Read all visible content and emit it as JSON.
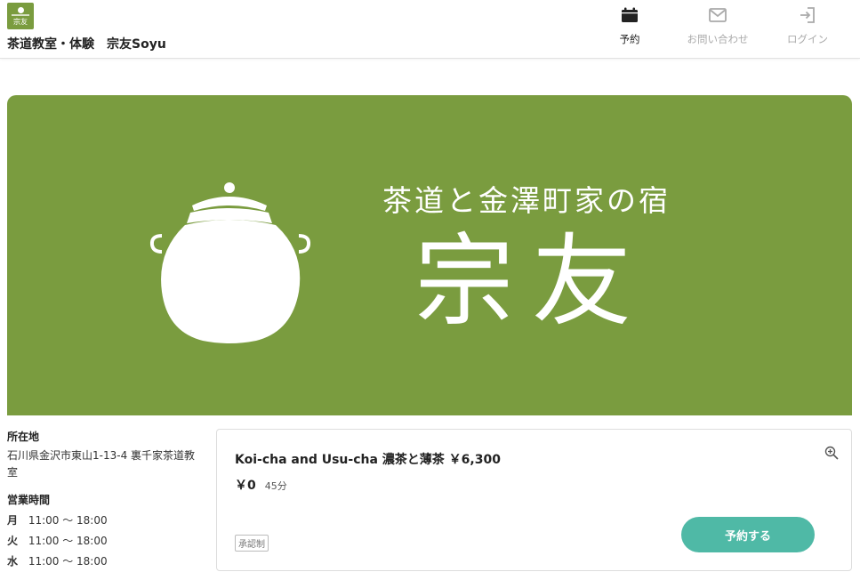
{
  "header": {
    "logo_text": "宗友",
    "shop_title": "茶道教室・体験　宗友Soyu",
    "nav": [
      {
        "label": "予約",
        "icon": "calendar-icon",
        "active": true
      },
      {
        "label": "お問い合わせ",
        "icon": "mail-icon",
        "active": false
      },
      {
        "label": "ログイン",
        "icon": "login-icon",
        "active": false
      }
    ]
  },
  "banner": {
    "subtitle": "茶道と金澤町家の宿",
    "main_title": "宗友",
    "background": "#7a9c3f",
    "image_icon": "tea-kettle-icon"
  },
  "info": {
    "address_label": "所在地",
    "address": "石川県金沢市東山1-13-4 裏千家茶道教室",
    "hours_label": "営業時間",
    "hours": [
      {
        "day": "月",
        "time": "11:00 〜 18:00"
      },
      {
        "day": "火",
        "time": "11:00 〜 18:00"
      },
      {
        "day": "水",
        "time": "11:00 〜 18:00"
      }
    ]
  },
  "card": {
    "title": "Koi-cha and Usu-cha 濃茶と薄茶 ￥6,300",
    "price": "￥0",
    "duration": "45分",
    "badge": "承認制",
    "button_label": "予約する",
    "button_color": "#4fb9a6",
    "zoom_icon": "zoom-in-icon"
  }
}
